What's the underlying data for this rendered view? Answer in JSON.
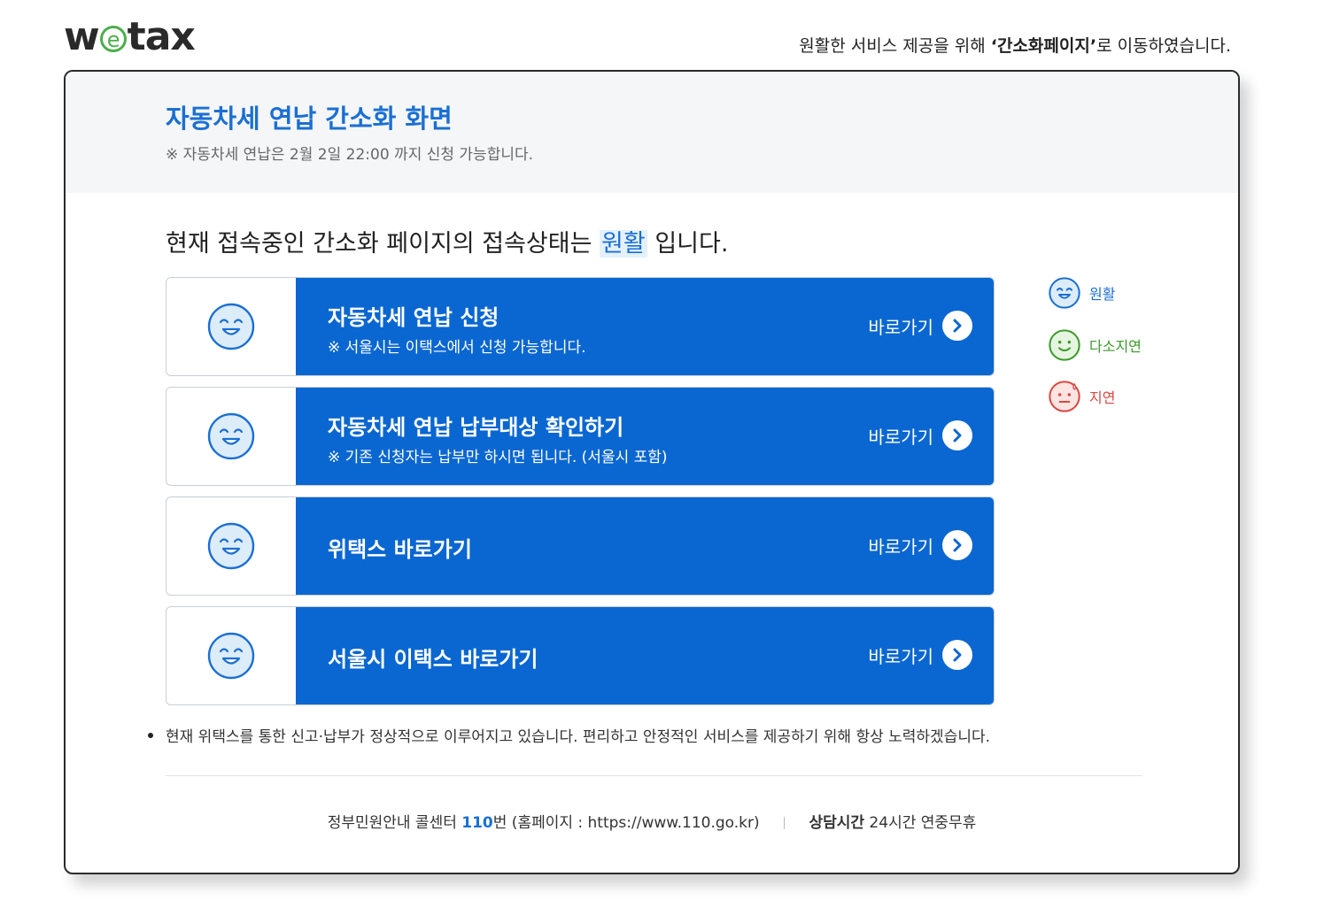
{
  "header": {
    "logo_pre": "w",
    "logo_e": "e",
    "logo_post": "tax",
    "notice_pre": "원활한 서비스 제공을 위해 ",
    "notice_bold": "‘간소화페이지’",
    "notice_post": "로 이동하였습니다."
  },
  "page": {
    "title": "자동차세 연납 간소화 화면",
    "subtitle": "※ 자동차세 연납은 2월 2일 22:00 까지 신청 가능합니다."
  },
  "status": {
    "prefix": "현재 접속중인 간소화 페이지의 접속상태는 ",
    "value": "원활",
    "suffix": " 입니다."
  },
  "cards": [
    {
      "title": "자동차세 연납 신청",
      "desc": "※ 서울시는 이택스에서 신청 가능합니다.",
      "go": "바로가기"
    },
    {
      "title": "자동차세 연납 납부대상 확인하기",
      "desc": "※ 기존 신청자는 납부만 하시면 됩니다. (서울시 포함)",
      "go": "바로가기"
    },
    {
      "title": "위택스 바로가기",
      "desc": "",
      "go": "바로가기"
    },
    {
      "title": "서울시 이택스 바로가기",
      "desc": "",
      "go": "바로가기"
    }
  ],
  "legend": [
    {
      "label": "원활",
      "color": "#1a6fd3",
      "icon": "smile-face-icon"
    },
    {
      "label": "다소지연",
      "color": "#3b9a2a",
      "icon": "neutral-smile-face-icon"
    },
    {
      "label": "지연",
      "color": "#d9473f",
      "icon": "sad-face-icon"
    }
  ],
  "note": "현재 위택스를 통한 신고·납부가 정상적으로 이루어지고 있습니다. 편리하고 안정적인 서비스를 제공하기 위해 항상 노력하겠습니다.",
  "footer": {
    "callcenter_pre": "정부민원안내 콜센터 ",
    "callcenter_num": "110",
    "callcenter_post": "번 (홈페이지 : https://www.110.go.kr)",
    "hours_label": "상담시간",
    "hours_value": " 24시간 연중무휴"
  }
}
